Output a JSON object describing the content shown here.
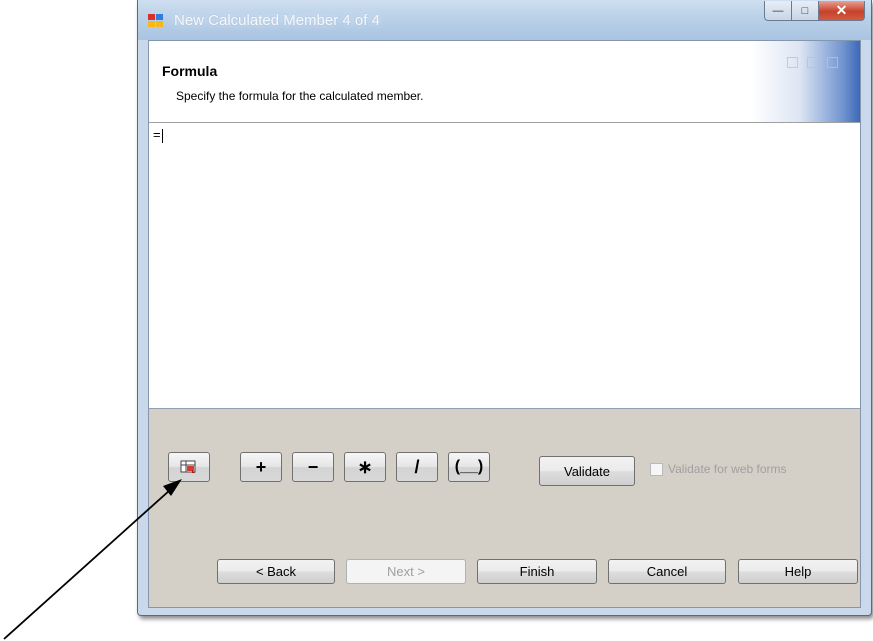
{
  "window": {
    "title": "New Calculated Member 4 of 4",
    "minimize_glyph": "—",
    "maximize_glyph": "□",
    "close_glyph": "✕"
  },
  "header": {
    "title": "Formula",
    "subtitle": "Specify the formula for the calculated member."
  },
  "formula": {
    "value": "="
  },
  "toolbar": {
    "insert_field_icon": "field-picker-icon",
    "plus_label": "+",
    "minus_label": "−",
    "multiply_label": "∗",
    "divide_label": "/",
    "parentheses_label": "(__)",
    "validate_label": "Validate",
    "validate_web_forms_label": "Validate for web forms",
    "validate_web_forms_checked": false
  },
  "footer": {
    "back_label": "< Back",
    "next_label": "Next >",
    "finish_label": "Finish",
    "cancel_label": "Cancel",
    "help_label": "Help"
  },
  "colors": {
    "titlebar": "#b9d0e8",
    "client_bg": "#d4d0c8",
    "close_button": "#c7422b",
    "header_graphic": "#3c68b8"
  }
}
